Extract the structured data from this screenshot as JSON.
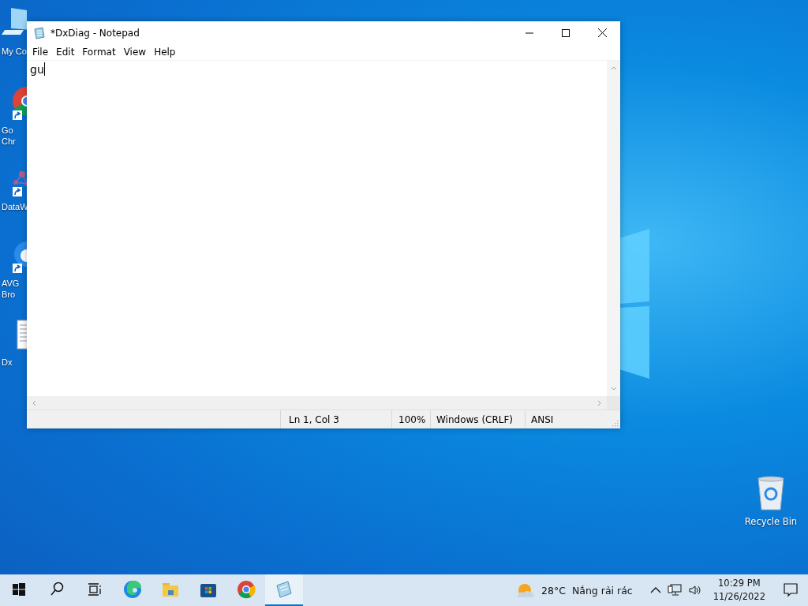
{
  "desktop_icons": [
    {
      "kind": "computer",
      "label": "My Co",
      "shortcut": false
    },
    {
      "kind": "chrome",
      "label": "Go\nChr",
      "shortcut": true
    },
    {
      "kind": "molecule",
      "label": "DataW",
      "shortcut": true
    },
    {
      "kind": "avg",
      "label": "AVG\nBro",
      "shortcut": true
    },
    {
      "kind": "document",
      "label": "Dx",
      "shortcut": false
    }
  ],
  "recycle_bin": {
    "label": "Recycle Bin"
  },
  "window": {
    "title": "*DxDiag - Notepad",
    "menu": [
      "File",
      "Edit",
      "Format",
      "View",
      "Help"
    ],
    "text": "gu",
    "status_bar": [
      "Ln 1, Col 3",
      "100%",
      "Windows (CRLF)",
      "ANSI"
    ]
  },
  "taskbar": {
    "apps": [
      {
        "kind": "start",
        "active": false
      },
      {
        "kind": "search",
        "active": false
      },
      {
        "kind": "taskview",
        "active": false
      },
      {
        "kind": "edge",
        "active": false
      },
      {
        "kind": "explorer",
        "active": false
      },
      {
        "kind": "store",
        "active": false
      },
      {
        "kind": "chrome",
        "active": false
      },
      {
        "kind": "notepad",
        "active": true
      }
    ],
    "weather": {
      "temperature": "28°C",
      "condition": "Nắng rải rác"
    },
    "clock": {
      "time": "10:29 PM",
      "date": "11/26/2022"
    }
  }
}
